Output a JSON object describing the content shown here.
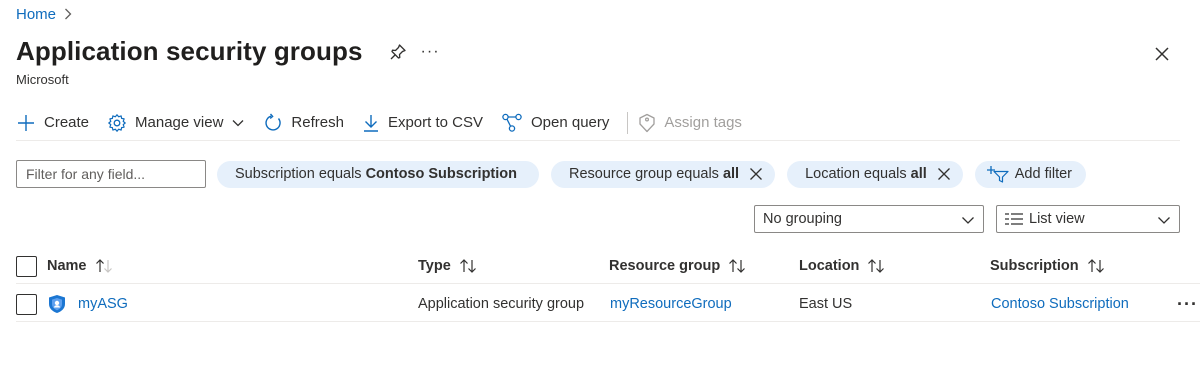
{
  "breadcrumb": {
    "home": "Home",
    "separator": ">"
  },
  "page": {
    "title": "Application security groups",
    "subtitle": "Microsoft",
    "more": "···"
  },
  "toolbar": {
    "create": "Create",
    "manage_view": "Manage view",
    "refresh": "Refresh",
    "export_csv": "Export to CSV",
    "open_query": "Open query",
    "assign_tags": "Assign tags"
  },
  "filters": {
    "placeholder": "Filter for any field...",
    "pills": [
      {
        "label": "Subscription equals",
        "value": "Contoso Subscription",
        "removable": false
      },
      {
        "label": "Resource group equals",
        "value": "all",
        "removable": true
      },
      {
        "label": "Location equals",
        "value": "all",
        "removable": true
      }
    ],
    "add_filter": "Add filter"
  },
  "view_controls": {
    "grouping": "No grouping",
    "view": "List view"
  },
  "table": {
    "columns": [
      "Name",
      "Type",
      "Resource group",
      "Location",
      "Subscription"
    ],
    "rows": [
      {
        "name": "myASG",
        "type": "Application security group",
        "resource_group": "myResourceGroup",
        "location": "East US",
        "subscription": "Contoso Subscription"
      }
    ],
    "row_more": "···"
  },
  "icons": {
    "pin": "pin-icon",
    "close": "close-icon",
    "create": "plus-icon",
    "manage_view": "gear-icon",
    "refresh": "refresh-icon",
    "export": "download-icon",
    "query": "query-icon",
    "tag": "tag-icon",
    "add_filter": "add-filter-icon",
    "asg": "shield-icon"
  },
  "colors": {
    "accent": "#0f6cbd",
    "pill_bg": "#e6f0fb",
    "text": "#323130",
    "disabled": "#a19f9d"
  }
}
